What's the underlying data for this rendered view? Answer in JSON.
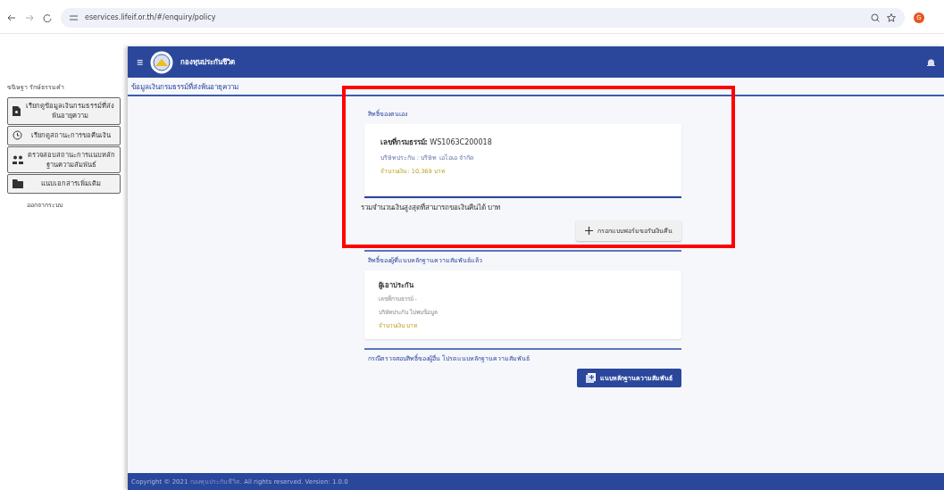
{
  "browser": {
    "url": "eservices.lifeif.or.th/#/enquiry/policy",
    "profile_initial": "G"
  },
  "sidebar": {
    "user": "ขนิษฐา รักษ์ธรรมคำ",
    "items": [
      {
        "label": "เรียกดูข้อมูลเงินกรมธรรม์ที่ส่งพ้นอายุความ",
        "kind": "document"
      },
      {
        "label": "เรียกดูสถานะการขอคืนเงิน",
        "kind": "history"
      },
      {
        "label": "ตรวจสอบสถานะการแนบหลักฐานความสัมพันธ์",
        "kind": "people"
      },
      {
        "label": "แนบเอกสารเพิ่มเติม",
        "kind": "folder"
      }
    ],
    "logout": "ออกจากระบบ"
  },
  "header": {
    "menu": "≡",
    "title": "กองทุนประกันชีวิต"
  },
  "page_title": "ข้อมูลเงินกรมธรรม์ที่ส่งพ้นอายุความ",
  "own_rights": {
    "title": "สิทธิ์ของตนเอง",
    "policies": [
      {
        "number_label": "เลขที่กรมธรรม์:",
        "number": "WS1063C200018",
        "company": "บริษัทประกัน : บริษัท เอไอเอ จำกัด",
        "amount": "จำนวนเงิน : 10,369 บาท"
      }
    ],
    "total": "รวมจำนวนเงินสูงสุดที่สามารถขอเงินคืนได้ บาท",
    "button": "กรอกแบบฟอร์มขอรับเงินคืน"
  },
  "related_rights": {
    "title": "สิทธิ์ของผู้ที่แนบหลักฐานความสัมพันธ์แล้ว",
    "cards": [
      {
        "insured": "ผู้เอาประกัน",
        "number": "เลขที่กรมธรรม์ -",
        "company": "บริษัทประกัน ไม่พบข้อมูล",
        "amount": "จำนวนเงิน บาท"
      }
    ]
  },
  "others": {
    "note": "กรณีตรวจสอบสิทธิ์ของผู้อื่น โปรดแนบหลักฐานความสัมพันธ์",
    "button": "แนบหลักฐานความสัมพันธ์"
  },
  "footer": {
    "copyright": "Copyright © 2021",
    "org": "กองทุนประกันชีวิต",
    "rest": ". All rights reserved. Version: 1.0.0"
  }
}
